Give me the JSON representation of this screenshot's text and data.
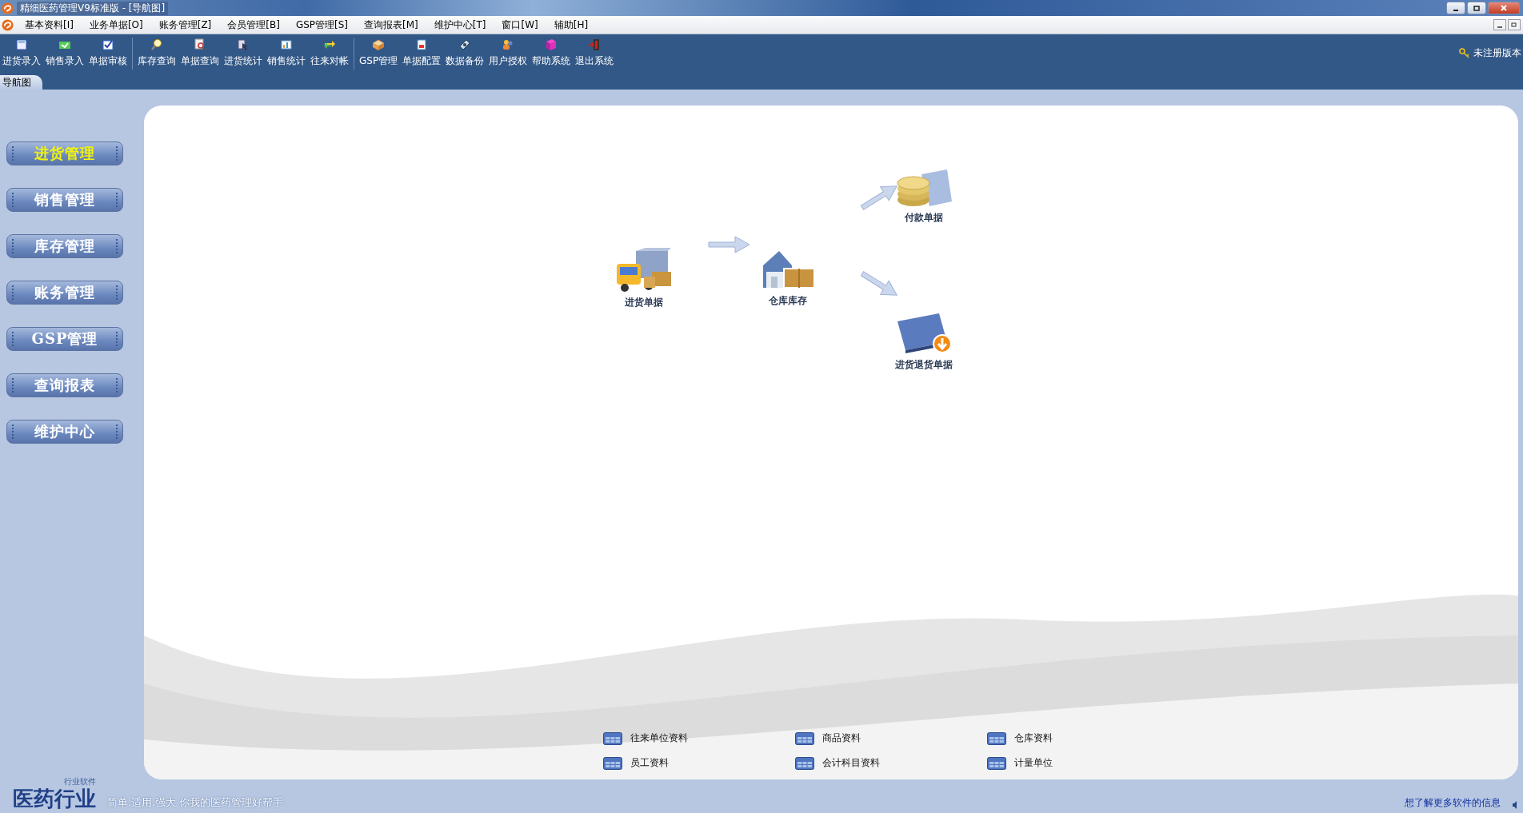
{
  "window": {
    "title": "精细医药管理V9标准版 - [导航图]"
  },
  "menu": [
    "基本资料[I]",
    "业务单据[O]",
    "账务管理[Z]",
    "会员管理[B]",
    "GSP管理[S]",
    "查询报表[M]",
    "维护中心[T]",
    "窗口[W]",
    "辅助[H]"
  ],
  "toolbar": {
    "groups": [
      [
        {
          "label": "进货录入"
        },
        {
          "label": "销售录入"
        },
        {
          "label": "单据审核"
        }
      ],
      [
        {
          "label": "库存查询"
        },
        {
          "label": "单据查询"
        },
        {
          "label": "进货统计"
        },
        {
          "label": "销售统计"
        },
        {
          "label": "往来对帐"
        }
      ],
      [
        {
          "label": "GSP管理"
        },
        {
          "label": "单据配置"
        },
        {
          "label": "数据备份"
        },
        {
          "label": "用户授权"
        },
        {
          "label": "帮助系统"
        },
        {
          "label": "退出系统"
        }
      ]
    ],
    "registration": "未注册版本"
  },
  "tabs": [
    {
      "label": "导航图",
      "selected": true
    }
  ],
  "sidebar": {
    "items": [
      {
        "label": "进货管理",
        "selected": true
      },
      {
        "label": "销售管理",
        "selected": false
      },
      {
        "label": "库存管理",
        "selected": false
      },
      {
        "label": "账务管理",
        "selected": false
      },
      {
        "label": "GSP管理",
        "selected": false
      },
      {
        "label": "查询报表",
        "selected": false
      },
      {
        "label": "维护中心",
        "selected": false
      }
    ]
  },
  "diagram": {
    "nodes": [
      {
        "label": "进货单据",
        "kind": "truck"
      },
      {
        "label": "仓库库存",
        "kind": "warehouse"
      },
      {
        "label": "付款单据",
        "kind": "coins"
      },
      {
        "label": "进货退货单据",
        "kind": "return"
      }
    ]
  },
  "quick_links": [
    {
      "label": "往来单位资料"
    },
    {
      "label": "商品资料"
    },
    {
      "label": "仓库资料"
    },
    {
      "label": "员工资料"
    },
    {
      "label": "会计科目资料"
    },
    {
      "label": "计量单位"
    }
  ],
  "footer": {
    "logo": "医药行业",
    "logo_tag": "行业软件",
    "slogan": "简单.适用.强大 你我的医药管理好帮手",
    "info_link": "想了解更多软件的信息"
  }
}
